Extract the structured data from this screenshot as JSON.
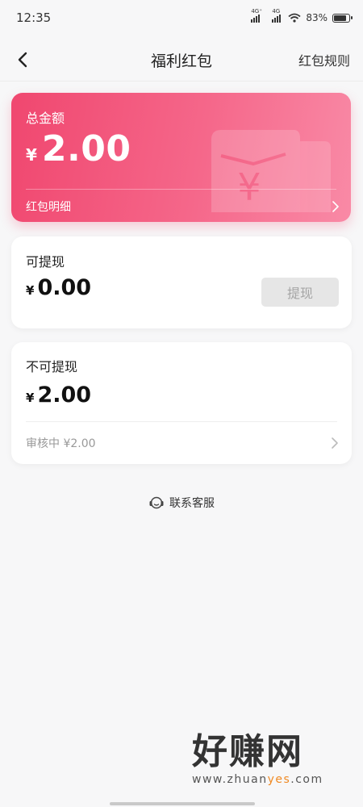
{
  "status_bar": {
    "time": "12:35",
    "network_1": "4G⁺",
    "network_2": "4G",
    "battery_percent": "83%",
    "battery_level": 0.83
  },
  "nav": {
    "title": "福利红包",
    "rules_label": "红包规则",
    "back_icon": "chevron-left-icon"
  },
  "total_card": {
    "label": "总金额",
    "currency": "¥",
    "amount": "2.00",
    "detail_label": "红包明细",
    "gradient_start": "#f0476f",
    "gradient_end": "#f98aa6"
  },
  "withdrawable_card": {
    "label": "可提现",
    "currency": "¥",
    "amount": "0.00",
    "button_label": "提现"
  },
  "nonwithdrawable_card": {
    "label": "不可提现",
    "currency": "¥",
    "amount": "2.00",
    "review_text": "审核中 ¥2.00"
  },
  "support": {
    "label": "联系客服",
    "icon": "headset-icon"
  },
  "watermark": {
    "text": "好赚网",
    "url_prefix": "www.zhuan",
    "url_highlight": "yes",
    "url_suffix": ".com"
  }
}
